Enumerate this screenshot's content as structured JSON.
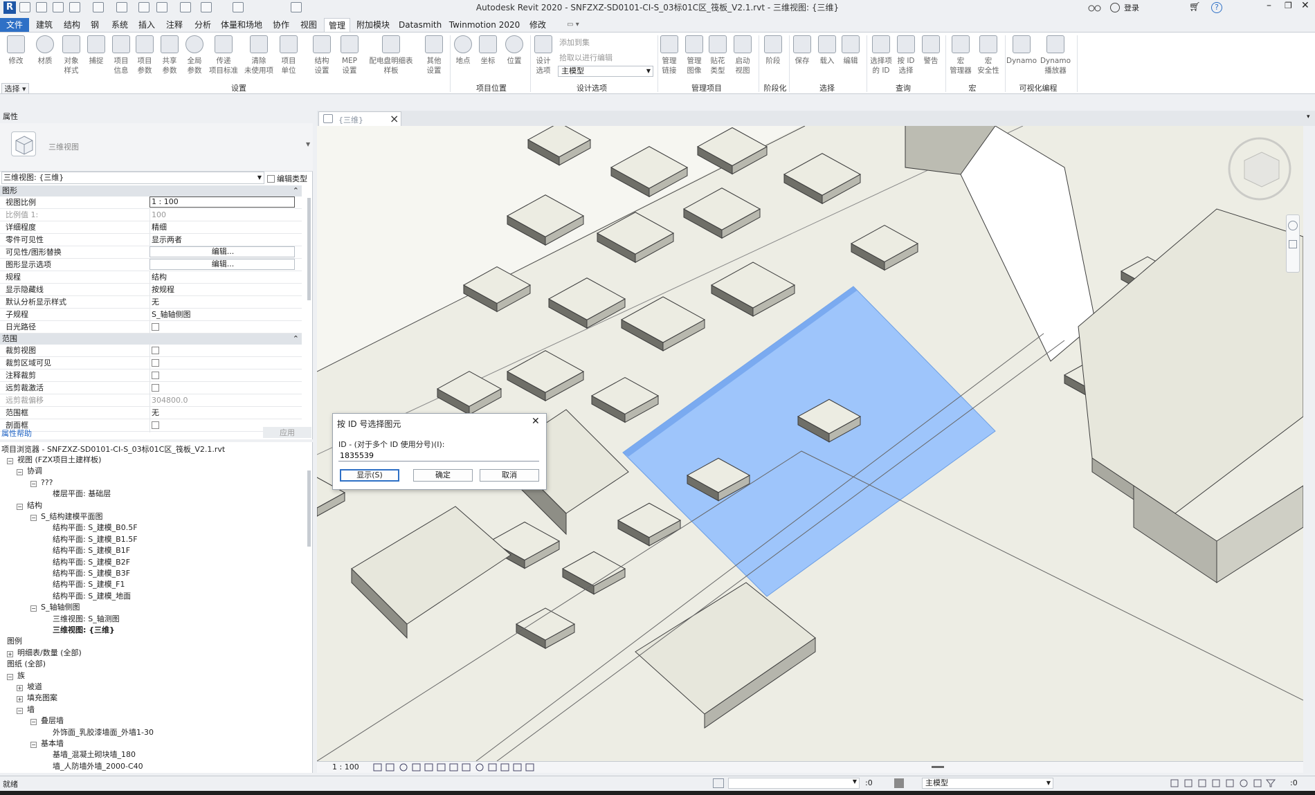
{
  "window": {
    "title": "Autodesk Revit 2020 - SNFZXZ-SD0101-CI-S_03标01C区_筏板_V2.1.rvt - 三维视图: {三维}",
    "login_label": "登录"
  },
  "menu": {
    "tabs": [
      "文件",
      "建筑",
      "结构",
      "钢",
      "系统",
      "插入",
      "注释",
      "分析",
      "体量和场地",
      "协作",
      "视图",
      "管理",
      "附加模块",
      "Datasmith",
      "Twinmotion 2020",
      "修改"
    ],
    "active": "管理"
  },
  "ribbon": {
    "select_panel_label": "选择 ▾",
    "buttons": {
      "modify": "修改",
      "materials": "材质",
      "object_styles": "对象\n样式",
      "snaps": "捕捉",
      "project_info": "项目\n信息",
      "project_params": "项目\n参数",
      "shared_params": "共享\n参数",
      "global_params": "全局\n参数",
      "transfer_std": "传递\n项目标准",
      "purge": "清除\n未使用项",
      "project_units": "项目\n单位",
      "struct_settings": "结构\n设置",
      "mep_settings": "MEP\n设置",
      "panel_templates": "配电盘明细表\n样板",
      "other_settings": "其他\n设置",
      "location": "地点",
      "coordinates": "坐标",
      "position": "位置",
      "design_options": "设计\n选项",
      "add_to_set": "添加到集",
      "pick_to_edit": "拾取以进行编辑",
      "main_model": "主模型",
      "manage_links": "管理\n链接",
      "manage_images": "管理\n图像",
      "decal_types": "贴花\n类型",
      "starting_view": "启动\n视图",
      "phases": "阶段",
      "save_sel": "保存",
      "load_sel": "载入",
      "edit_sel": "编辑",
      "select_by_id_from": "选择项\n的 ID",
      "select_by_id": "按 ID\n选择",
      "warnings": "警告",
      "macro_manager": "宏\n管理器",
      "macro_security": "宏\n安全性",
      "dynamo": "Dynamo",
      "dynamo_player": "Dynamo\n播放器"
    },
    "groups": {
      "settings": "设置",
      "project_location": "项目位置",
      "design_options": "设计选项",
      "manage_project": "管理项目",
      "phasing": "阶段化",
      "selection": "选择",
      "inquiry": "查询",
      "macros": "宏",
      "visual_programming": "可视化编程"
    }
  },
  "properties": {
    "header": "属性",
    "type_name": "三维视图",
    "view_selector": "三维视图: {三维}",
    "edit_type": "编辑类型",
    "section_graphics": "图形",
    "rows_graphics": [
      {
        "k": "视图比例",
        "v": "1 : 100",
        "style": "boxed"
      },
      {
        "k": "比例值 1:",
        "v": "100",
        "style": "dim"
      },
      {
        "k": "详细程度",
        "v": "精细"
      },
      {
        "k": "零件可见性",
        "v": "显示两者"
      },
      {
        "k": "可见性/图形替换",
        "v": "编辑...",
        "style": "btn"
      },
      {
        "k": "图形显示选项",
        "v": "编辑...",
        "style": "btn"
      },
      {
        "k": "规程",
        "v": "结构"
      },
      {
        "k": "显示隐藏线",
        "v": "按规程"
      },
      {
        "k": "默认分析显示样式",
        "v": "无"
      },
      {
        "k": "子规程",
        "v": "S_轴轴侧图"
      },
      {
        "k": "日光路径",
        "v": "",
        "style": "check"
      }
    ],
    "section_extents": "范围",
    "rows_extents": [
      {
        "k": "裁剪视图",
        "v": "",
        "style": "check"
      },
      {
        "k": "裁剪区域可见",
        "v": "",
        "style": "check"
      },
      {
        "k": "注释裁剪",
        "v": "",
        "style": "check"
      },
      {
        "k": "远剪裁激活",
        "v": "",
        "style": "check"
      },
      {
        "k": "远剪裁偏移",
        "v": "304800.0",
        "style": "dim"
      },
      {
        "k": "范围框",
        "v": "无"
      },
      {
        "k": "剖面框",
        "v": "",
        "style": "check"
      }
    ],
    "help_link": "属性帮助",
    "apply_button": "应用"
  },
  "project_browser": {
    "header": "项目浏览器 - SNFZXZ-SD0101-CI-S_03标01C区_筏板_V2.1.rvt",
    "nodes": [
      {
        "t": "视图 (FZX项目土建样板)",
        "lvl": 0,
        "exp": "−"
      },
      {
        "t": "协调",
        "lvl": 1,
        "exp": "−"
      },
      {
        "t": "???",
        "lvl": 2,
        "exp": "−"
      },
      {
        "t": "楼层平面: 基础层",
        "lvl": 3
      },
      {
        "t": "结构",
        "lvl": 1,
        "exp": "−"
      },
      {
        "t": "S_结构建模平面图",
        "lvl": 2,
        "exp": "−"
      },
      {
        "t": "结构平面: S_建模_B0.5F",
        "lvl": 3
      },
      {
        "t": "结构平面: S_建模_B1.5F",
        "lvl": 3
      },
      {
        "t": "结构平面: S_建模_B1F",
        "lvl": 3
      },
      {
        "t": "结构平面: S_建模_B2F",
        "lvl": 3
      },
      {
        "t": "结构平面: S_建模_B3F",
        "lvl": 3
      },
      {
        "t": "结构平面: S_建模_F1",
        "lvl": 3
      },
      {
        "t": "结构平面: S_建模_地面",
        "lvl": 3
      },
      {
        "t": "S_轴轴侧图",
        "lvl": 2,
        "exp": "−"
      },
      {
        "t": "三维视图: S_轴测图",
        "lvl": 3
      },
      {
        "t": "三维视图: {三维}",
        "lvl": 3,
        "bold": true
      },
      {
        "t": "图例",
        "lvl": 0
      },
      {
        "t": "明细表/数量 (全部)",
        "lvl": 0,
        "exp": "+"
      },
      {
        "t": "图纸 (全部)",
        "lvl": 0
      },
      {
        "t": "族",
        "lvl": 0,
        "exp": "−"
      },
      {
        "t": "坡道",
        "lvl": 1,
        "exp": "+"
      },
      {
        "t": "填充图案",
        "lvl": 1,
        "exp": "+"
      },
      {
        "t": "墙",
        "lvl": 1,
        "exp": "−"
      },
      {
        "t": "叠层墙",
        "lvl": 2,
        "exp": "−"
      },
      {
        "t": "外饰面_乳胶漆墙面_外墙1-30",
        "lvl": 3
      },
      {
        "t": "基本墙",
        "lvl": 2,
        "exp": "−"
      },
      {
        "t": "基墙_混凝土砌块墙_180",
        "lvl": 3
      },
      {
        "t": "墙_人防墙外墙_2000-C40",
        "lvl": 3
      }
    ]
  },
  "view": {
    "tab_title": "{三维}",
    "scale": "1 : 100"
  },
  "dialog": {
    "title": "按 ID 号选择图元",
    "label": "ID - (对于多个 ID 使用分号)(I):",
    "value": "1835539",
    "btn_show": "显示(S)",
    "btn_ok": "确定",
    "btn_cancel": "取消"
  },
  "status": {
    "text": "就绪",
    "model_label": "主模型",
    "count": ":0",
    "filter_count": ":0"
  },
  "colors": {
    "accent": "#2e70c6",
    "selection": "#9ec5fb",
    "model_face": "#e9e8dd"
  }
}
